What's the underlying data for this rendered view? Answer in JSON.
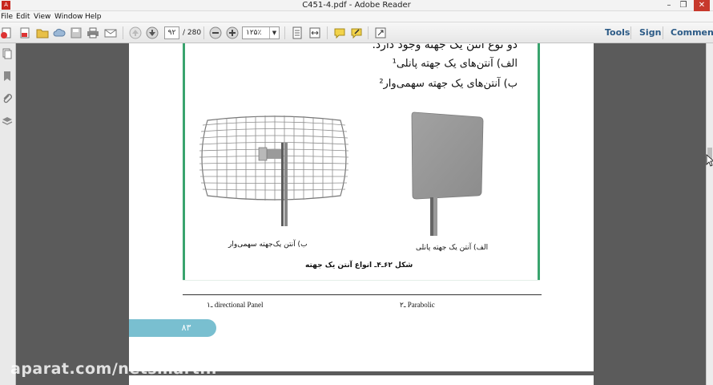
{
  "window": {
    "title": "C451-4.pdf - Adobe Reader",
    "app_icon": "acrobat-icon"
  },
  "menu": [
    "File",
    "Edit",
    "View",
    "Window",
    "Help"
  ],
  "toolbar": {
    "page_current": "۹۲",
    "page_total": "/ 280",
    "zoom": "۱۲۵٪",
    "tools": "Tools",
    "sign": "Sign",
    "comment": "Comment"
  },
  "document": {
    "line1": "دو نوع آنتن یک جهته وجود دارد.",
    "line2": "الف) آنتن‌های یک جهته پانلی¹",
    "line3": "ب) آنتن‌های یک جهته سهمی‌وار²",
    "caption_grid": "ب) آنتن یک‌جهته سهمی‌وار",
    "caption_panel": "الف) آنتن یک جهته پانلی",
    "figure_caption": "شکل ۶۲ـ۴ـ انواع آنتن یک جهته",
    "footnote_1": "۱ـ directional Panel",
    "footnote_2": "۲ـ Parabolic",
    "page_number": "۸۳"
  },
  "watermark": "aparat.com/netsmart.ir",
  "colors": {
    "frame_green": "#3aa46e",
    "page_tab": "#79bfd0",
    "close_red": "#c7392c",
    "link_blue": "#2b5a86"
  }
}
